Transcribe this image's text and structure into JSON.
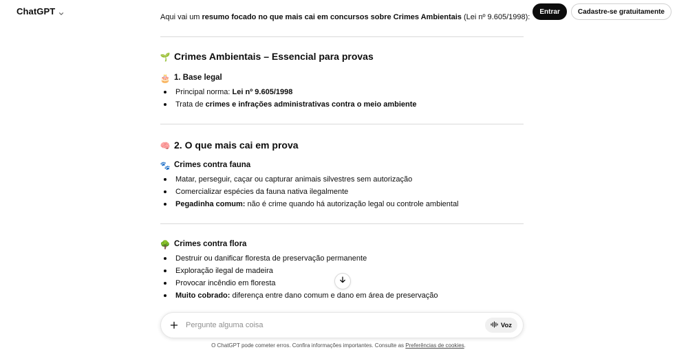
{
  "app": {
    "title": "ChatGPT"
  },
  "header": {
    "login_label": "Entrar",
    "signup_label": "Cadastre-se gratuitamente"
  },
  "message": {
    "intro_pre": "Aqui vai um ",
    "intro_bold": "resumo focado no que mais cai em concursos sobre Crimes Ambientais",
    "intro_post": " (Lei nº 9.605/1998):",
    "title_emoji": "🌱",
    "title": "Crimes Ambientais – Essencial para provas",
    "s1": {
      "emoji": "🎂",
      "heading": "1. Base legal",
      "items": [
        {
          "pre": "Principal norma: ",
          "bold": "Lei nº 9.605/1998",
          "post": ""
        },
        {
          "pre": "Trata de ",
          "bold": "crimes e infrações administrativas contra o meio ambiente",
          "post": ""
        }
      ]
    },
    "s2": {
      "emoji": "🧠",
      "heading": "2. O que mais cai em prova"
    },
    "fauna": {
      "emoji": "🐾",
      "heading": "Crimes contra fauna",
      "items": [
        {
          "pre": "Matar, perseguir, caçar ou capturar animais silvestres sem autorização",
          "bold": "",
          "post": ""
        },
        {
          "pre": "Comercializar espécies da fauna nativa ilegalmente",
          "bold": "",
          "post": ""
        },
        {
          "pre": "",
          "bold": "Pegadinha comum:",
          "post": " não é crime quando há autorização legal ou controle ambiental"
        }
      ]
    },
    "flora": {
      "emoji": "🌳",
      "heading": "Crimes contra flora",
      "items": [
        {
          "pre": "Destruir ou danificar floresta de preservação permanente",
          "bold": "",
          "post": ""
        },
        {
          "pre": "Exploração ilegal de madeira",
          "bold": "",
          "post": ""
        },
        {
          "pre": "Provocar incêndio em floresta",
          "bold": "",
          "post": ""
        },
        {
          "pre": "",
          "bold": "Muito cobrado:",
          "post": " diferença entre dano comum e dano em área de preservação"
        }
      ]
    }
  },
  "composer": {
    "placeholder": "Pergunte alguma coisa",
    "voice_label": "Voz"
  },
  "footer": {
    "text": "O ChatGPT pode cometer erros. Confira informações importantes. Consulte as ",
    "link": "Preferências de cookies",
    "end": "."
  },
  "icons": {
    "model_menu": "chevron-down-icon",
    "scroll": "arrow-down-icon",
    "attach": "plus-icon",
    "voice": "waveform-icon"
  }
}
